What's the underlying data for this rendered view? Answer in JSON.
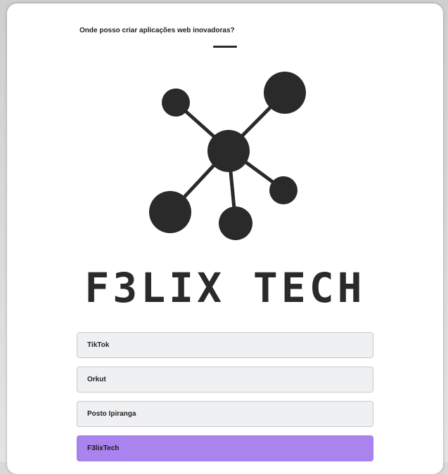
{
  "quiz": {
    "question": "Onde posso criar aplicações web inovadoras?",
    "logo_text": "F3LIX TECH",
    "options": [
      {
        "label": "TikTok",
        "selected": false
      },
      {
        "label": "Orkut",
        "selected": false
      },
      {
        "label": "Posto Ipiranga",
        "selected": false
      },
      {
        "label": "F3lixTech",
        "selected": true
      }
    ]
  },
  "colors": {
    "selected_option": "#ab83ee",
    "option_background": "#eff0f2",
    "logo": "#2a2a2a"
  }
}
